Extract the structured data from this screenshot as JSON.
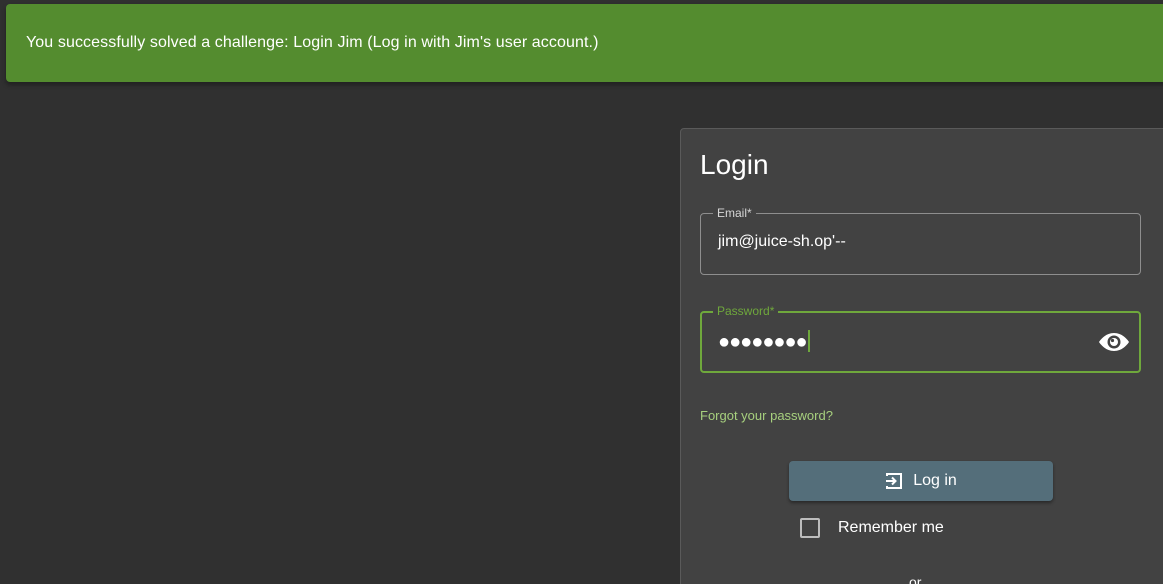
{
  "snackbar": {
    "message": "You successfully solved a challenge: Login Jim (Log in with Jim's user account.)"
  },
  "login": {
    "title": "Login",
    "email": {
      "label": "Email*",
      "value": "jim@juice-sh.op'--"
    },
    "password": {
      "label": "Password*",
      "masked_value": "●●●●●●●●",
      "toggle_icon": "eye-icon"
    },
    "forgot_password": "Forgot your password?",
    "login_button": {
      "label": "Log in",
      "icon": "login-icon"
    },
    "remember_me": {
      "label": "Remember me",
      "checked": false
    },
    "partial_text": "or"
  },
  "colors": {
    "background": "#303030",
    "snackbar": "#548c2f",
    "card": "#424242",
    "accent_green": "#6fa83c",
    "link_green": "#a7d07e",
    "button": "#546e7a"
  }
}
